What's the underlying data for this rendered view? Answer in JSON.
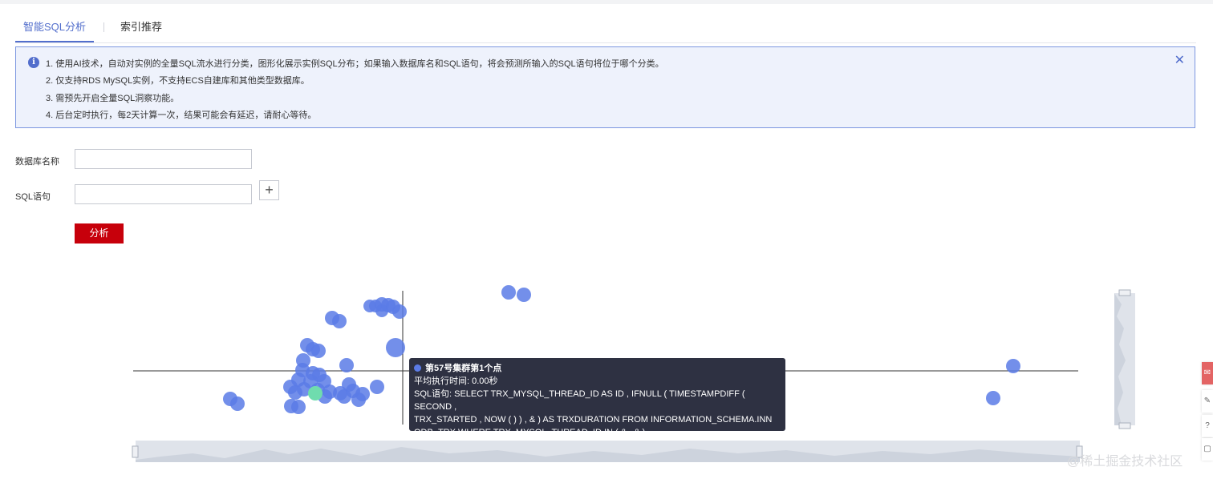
{
  "tabs": [
    {
      "label": "智能SQL分析",
      "active": true
    },
    {
      "label": "索引推荐",
      "active": false
    }
  ],
  "notice": {
    "icon": "info-icon",
    "lines": [
      "1. 使用AI技术，自动对实例的全量SQL流水进行分类，图形化展示实例SQL分布；如果输入数据库名和SQL语句，将会预测所输入的SQL语句将位于哪个分类。",
      "2. 仅支持RDS MySQL实例，不支持ECS自建库和其他类型数据库。",
      "3. 需预先开启全量SQL洞察功能。",
      "4. 后台定时执行，每2天计算一次，结果可能会有延迟，请耐心等待。"
    ],
    "close_icon": "close-icon"
  },
  "form": {
    "db_label": "数据库名称",
    "db_value": "",
    "sql_label": "SQL语句",
    "sql_value": "",
    "add_icon": "plus-icon",
    "analyze_label": "分析"
  },
  "tooltip": {
    "title": "第57号集群第1个点",
    "line1": "平均执行时间: 0.00秒",
    "line2": "SQL语句: SELECT TRX_MYSQL_THREAD_ID AS ID , IFNULL ( TIMESTAMPDIFF ( SECOND ,",
    "line3": "TRX_STARTED , NOW ( ) ) , & ) AS TRXDURATION FROM INFORMATION_SCHEMA.INN",
    "line4": "ODB_TRX WHERE TRX_MYSQL_THREAD_ID IN ( & , & )"
  },
  "colors": {
    "point": "#5b7be6",
    "highlight": "#6fdcae",
    "button": "#c7000b",
    "accent": "#526ecc"
  },
  "watermark": "@稀土掘金技术社区",
  "side_tools": [
    "feedback-icon",
    "edit-icon",
    "help-icon",
    "chat-icon"
  ]
}
